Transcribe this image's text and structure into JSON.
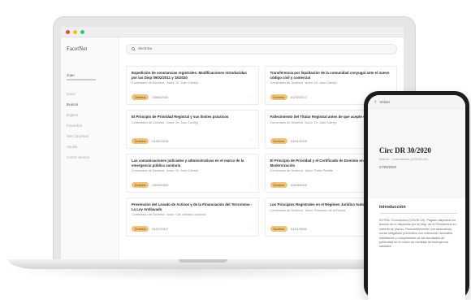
{
  "app": {
    "logo": "FacetNet",
    "user_name": "Juan",
    "search_value": "doctrina"
  },
  "sidebar": {
    "items": [
      {
        "label": "Inicio",
        "active": false
      },
      {
        "label": "Buscar",
        "active": true
      },
      {
        "label": "Dígitos",
        "active": false
      },
      {
        "label": "Favoritos",
        "active": false
      },
      {
        "label": "Mis Carpetas",
        "active": false
      },
      {
        "label": "Ayuda",
        "active": false
      },
      {
        "label": "Cerrar Sesión",
        "active": false
      }
    ]
  },
  "cards": [
    {
      "title": "Expedición de constancias registrales: Modificaciones introducidas por las Disp 09/02/2011 y 15/2020",
      "subtitle": "Comentario de Doctrina · Autor: Dr. Juan Carrejo",
      "badge": "Doctrina",
      "date": "25/05/2020"
    },
    {
      "title": "Transferencia por liquidación de la comunidad conyugal ante el nuevo código civil y comercial",
      "subtitle": "Comentario de Doctrina · Autor: Dr. Juan Carrejo",
      "badge": "Doctrina",
      "date": "01/02/2017"
    },
    {
      "title": "El Principio de Prioridad Registral y sus límites prácticos",
      "subtitle": "Comentario de Doctrina · Autor: Dr. Juan Carrejo",
      "badge": "Doctrina",
      "date": "01/02/2019"
    },
    {
      "title": "Fallecimiento del Titular Registral antes de que acepte el",
      "subtitle": "Comentario de Doctrina · Autor: Dr. Juan Carrejo",
      "badge": "Doctrina",
      "date": "01/01/2019"
    },
    {
      "title": "Las comunicaciones judiciales y administrativas en el marco de la emergencia pública sanitaria",
      "subtitle": "Comentario de Doctrina · Autor: Dr. Juan Carrejo",
      "badge": "Doctrina",
      "date": "25/03/2020"
    },
    {
      "title": "El Principio de Prioridad y el Certificado de Dominio en la Modernización",
      "subtitle": "Comentario de Doctrina · Autor: Pablo Peralta",
      "badge": "Doctrina",
      "date": "01/03/2019"
    },
    {
      "title": "Prevención del Lavado de Activos y de la Financiación del Terrorismo - La Ley Antilavado",
      "subtitle": "Comentario de Doctrina · Autor: Cdr. Adriana Lizcando",
      "badge": "Doctrina",
      "date": "01/07/2017"
    },
    {
      "title": "Los Principios Registrales en el Régimen Jurídico Automotor",
      "subtitle": "Comentario de Doctrina · Autor: Francisco de la Florida",
      "badge": "Doctrina",
      "date": "01/11/2016"
    }
  ],
  "phone": {
    "back_label": "Volver",
    "doc_title": "Circ DR 30/2020",
    "doc_subtitle": "Noticia · Coronavirus (COVID-19)",
    "doc_date": "27/03/2020",
    "section_title": "Introducción",
    "paragraph": "EXTRA: Coronavirus (COVID-19). Pagado dispuesto en función de lo dispuesto por la Disp. de la Presidencia en materia de plazos. Presumiblemente con aislamiento social obligatorio preventivo con restricción razonable, habilitación y cumplimiento de las facultades de publicidad en el marco de medidas de emergencia sanitaria."
  },
  "colors": {
    "badge_bg": "#f0c27a",
    "accent": "#e0a85a"
  }
}
